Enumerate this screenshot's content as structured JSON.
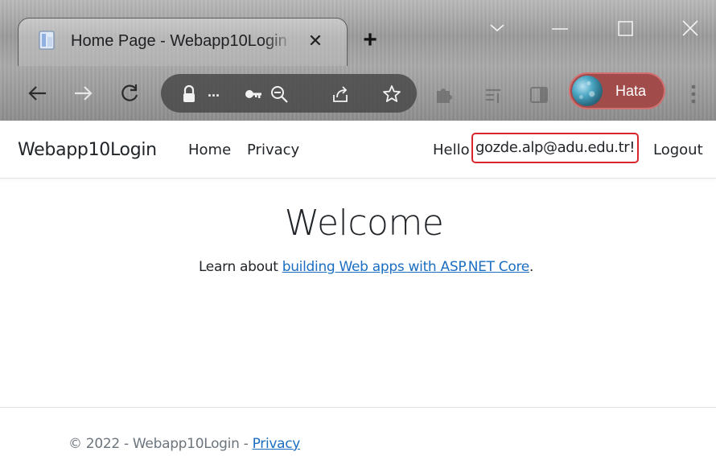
{
  "browser": {
    "tab_title": "Home Page - Webapp10Login",
    "tab_close_glyph": "✕",
    "new_tab_glyph": "+",
    "url_ellipsis": "...",
    "profile_label": "Hata",
    "profile_color": "#a14b4b"
  },
  "navbar": {
    "brand": "Webapp10Login",
    "links": [
      {
        "label": "Home"
      },
      {
        "label": "Privacy"
      }
    ],
    "hello_prefix": "Hello",
    "user_email": "gozde.alp@adu.edu.tr!",
    "logout_label": "Logout",
    "highlight_color": "#d9262b"
  },
  "main": {
    "heading": "Welcome",
    "learn_prefix": "Learn about ",
    "learn_link": "building Web apps with ASP.NET Core",
    "learn_suffix": "."
  },
  "footer": {
    "text": "© 2022 - Webapp10Login - ",
    "privacy_link": "Privacy"
  },
  "icons": {
    "back": "arrow-left-icon",
    "forward": "arrow-right-icon",
    "reload": "reload-icon",
    "lock": "lock-icon",
    "key": "key-icon",
    "zoom": "zoom-out-icon",
    "share": "share-icon",
    "bookmark": "star-icon",
    "extensions": "puzzle-icon",
    "reading_list": "reading-list-icon",
    "side_panel": "side-panel-icon",
    "menu": "kebab-menu-icon"
  },
  "colors": {
    "link": "#1b6ec2",
    "text": "#212529",
    "muted": "#6c757d"
  }
}
